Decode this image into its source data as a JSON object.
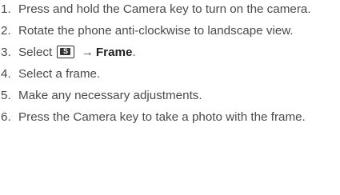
{
  "steps": [
    {
      "num": "1.",
      "text": "Press and hold the Camera key to turn on the camera."
    },
    {
      "num": "2.",
      "text": "Rotate the phone anti-clockwise to landscape view."
    },
    {
      "num": "3.",
      "before": "Select",
      "icon_name": "camera-settings-s-icon",
      "icon_letter": "S",
      "arrow": "→",
      "target": "Frame",
      "after": "."
    },
    {
      "num": "4.",
      "text": "Select a frame."
    },
    {
      "num": "5.",
      "text": "Make any necessary adjustments."
    },
    {
      "num": "6.",
      "text": "Press the Camera key to take a photo with the frame."
    }
  ]
}
